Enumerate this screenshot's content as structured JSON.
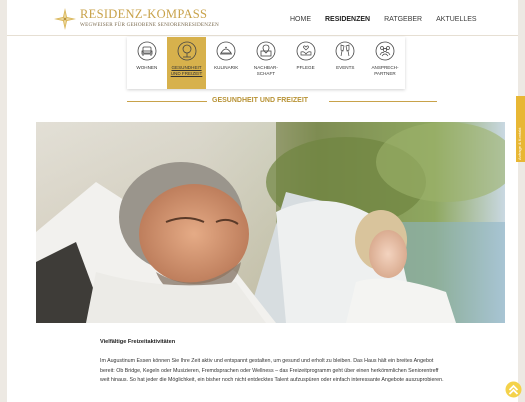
{
  "brand": {
    "title": "RESIDENZ-KOMPASS",
    "subtitle": "WEGWEISER FÜR GEHOBENE SENIORENRESIDENZEN"
  },
  "nav": {
    "items": [
      {
        "label": "HOME",
        "active": false
      },
      {
        "label": "RESIDENZEN",
        "active": true
      },
      {
        "label": "RATGEBER",
        "active": false
      },
      {
        "label": "AKTUELLES",
        "active": false
      }
    ]
  },
  "categories": [
    {
      "line1": "WOHNEN",
      "line2": "",
      "icon": "armchair-icon",
      "active": false
    },
    {
      "line1": "GESUNDHEIT",
      "line2": "UND FREIZEIT",
      "icon": "tree-icon",
      "active": true
    },
    {
      "line1": "KULINARIK",
      "line2": "",
      "icon": "cloche-icon",
      "active": false
    },
    {
      "line1": "NACHBAR-",
      "line2": "SCHAFT",
      "icon": "map-pin-icon",
      "active": false
    },
    {
      "line1": "PFLEGE",
      "line2": "",
      "icon": "hands-heart-icon",
      "active": false
    },
    {
      "line1": "EVENTS",
      "line2": "",
      "icon": "champagne-glasses-icon",
      "active": false
    },
    {
      "line1": "ANSPRECH-",
      "line2": "PARTNER",
      "icon": "people-icon",
      "active": false
    }
  ],
  "section_title": "GESUNDHEIT UND FREIZEIT",
  "article": {
    "heading": "Vielfältige Freizeitaktivitäten",
    "body": "Im Augustinum Essen können Sie Ihre Zeit aktiv und entspannt gestalten, um gesund und erholt zu bleiben. Das Haus hält ein breites Angebot bereit: Ob Bridge, Kegeln oder Musizieren, Fremdsprachen oder Wellness – das Freizeitprogramm geht über einen herkömmlichen Seniorentreff weit hinaus. So hat jeder die Möglichkeit, ein bisher noch nicht entdecktes Talent aufzuspüren oder einfach interessante Angebote auszuprobieren."
  },
  "side_tab": {
    "label": "Anfrage & Kontakt"
  },
  "colors": {
    "accent": "#c8a24a",
    "active_tile": "#d7b14c",
    "side_tab": "#e8b734"
  }
}
